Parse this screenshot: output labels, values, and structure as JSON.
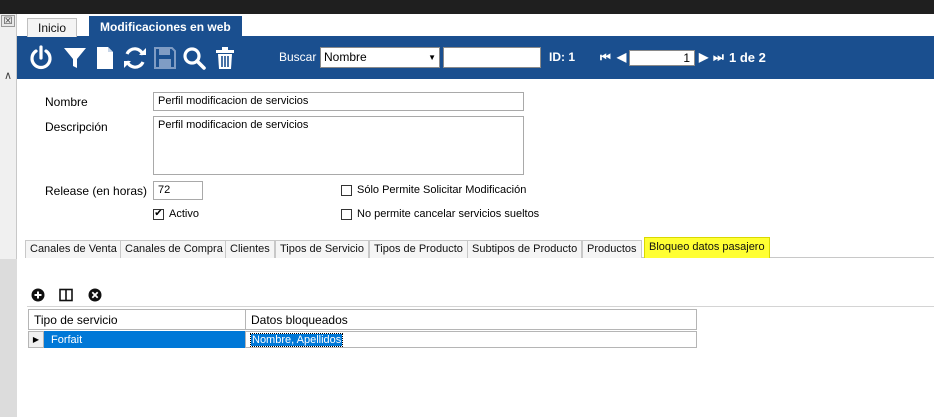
{
  "tabs": [
    {
      "label": "Inicio",
      "active": false
    },
    {
      "label": "Modificaciones en web",
      "active": true
    }
  ],
  "toolbar": {
    "icons": [
      "power-icon",
      "filter-icon",
      "new-document-icon",
      "refresh-icon",
      "save-icon",
      "search-icon",
      "delete-icon"
    ],
    "buscar_label": "Buscar",
    "buscar_option": "Nombre",
    "buscar_value": "",
    "id_label": "ID: 1",
    "page_value": "1",
    "page_count": "1 de 2"
  },
  "form": {
    "nombre_label": "Nombre",
    "nombre_value": "Perfil modificacion de servicios",
    "descripcion_label": "Descripción",
    "descripcion_value": "Perfil modificacion de servicios",
    "release_label": "Release (en horas)",
    "release_value": "72",
    "activo_label": "Activo",
    "activo_checked": true,
    "solo_label": "Sólo Permite Solicitar Modificación",
    "solo_checked": false,
    "no_cancel_label": "No permite cancelar servicios sueltos",
    "no_cancel_checked": false
  },
  "subtabs": [
    {
      "label": "Canales de Venta",
      "active": false
    },
    {
      "label": "Canales de Compra",
      "active": false
    },
    {
      "label": "Clientes",
      "active": false
    },
    {
      "label": "Tipos de Servicio",
      "active": false
    },
    {
      "label": "Tipos de Producto",
      "active": false
    },
    {
      "label": "Subtipos de Producto",
      "active": false
    },
    {
      "label": "Productos",
      "active": false
    },
    {
      "label": "Bloqueo datos pasajero",
      "active": true
    }
  ],
  "grid": {
    "columns": [
      "Tipo de servicio",
      "Datos bloqueados"
    ],
    "rows": [
      [
        "Forfait",
        "Nombre, Apellidos"
      ]
    ]
  },
  "colors": {
    "toolbar_bg": "#1a4f8f",
    "active_subtab": "#ffff33",
    "selection": "#0078d7"
  }
}
